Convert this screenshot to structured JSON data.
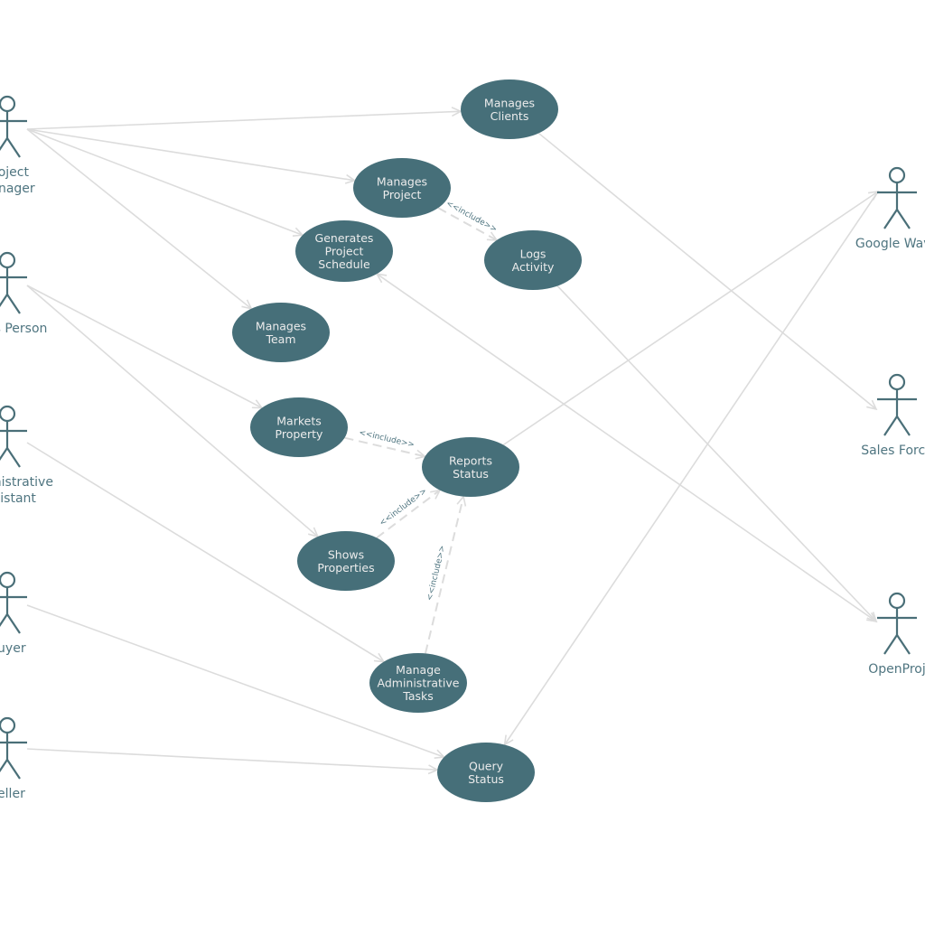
{
  "diagram": {
    "type": "UML use case diagram",
    "colors": {
      "use_case_fill": "#466f79",
      "use_case_text": "#ececec",
      "actor_stroke": "#4a6f78",
      "actor_label": "#4f7580",
      "connector": "#dcdcdc"
    },
    "actors": [
      {
        "id": "project-manager",
        "label_lines": [
          "Project",
          "Manager"
        ],
        "side": "left"
      },
      {
        "id": "sales-person",
        "label_lines": [
          "Sales Person"
        ],
        "side": "left"
      },
      {
        "id": "administrative-assistant",
        "label_lines": [
          "Administrative",
          "Assistant"
        ],
        "side": "left"
      },
      {
        "id": "buyer",
        "label_lines": [
          "Buyer"
        ],
        "side": "left"
      },
      {
        "id": "seller",
        "label_lines": [
          "Seller"
        ],
        "side": "left"
      },
      {
        "id": "google-wave",
        "label_lines": [
          "Google Wave"
        ],
        "side": "right"
      },
      {
        "id": "sales-force",
        "label_lines": [
          "Sales Force"
        ],
        "side": "right"
      },
      {
        "id": "openproj",
        "label_lines": [
          "OpenProj"
        ],
        "side": "right"
      }
    ],
    "use_cases": [
      {
        "id": "manages-clients",
        "label_lines": [
          "Manages",
          "Clients"
        ]
      },
      {
        "id": "manages-project",
        "label_lines": [
          "Manages",
          "Project"
        ]
      },
      {
        "id": "generates-project-schedule",
        "label_lines": [
          "Generates",
          "Project",
          "Schedule"
        ]
      },
      {
        "id": "logs-activity",
        "label_lines": [
          "Logs",
          "Activity"
        ]
      },
      {
        "id": "manages-team",
        "label_lines": [
          "Manages",
          "Team"
        ]
      },
      {
        "id": "markets-property",
        "label_lines": [
          "Markets",
          "Property"
        ]
      },
      {
        "id": "reports-status",
        "label_lines": [
          "Reports",
          "Status"
        ]
      },
      {
        "id": "shows-properties",
        "label_lines": [
          "Shows",
          "Properties"
        ]
      },
      {
        "id": "manage-administrative-tasks",
        "label_lines": [
          "Manage",
          "Administrative",
          "Tasks"
        ]
      },
      {
        "id": "query-status",
        "label_lines": [
          "Query",
          "Status"
        ]
      }
    ],
    "associations": [
      {
        "from": "project-manager",
        "to": "manages-clients",
        "arrow_end": true
      },
      {
        "from": "project-manager",
        "to": "manages-project",
        "arrow_end": true
      },
      {
        "from": "project-manager",
        "to": "generates-project-schedule",
        "arrow_end": true
      },
      {
        "from": "project-manager",
        "to": "manages-team",
        "arrow_end": true
      },
      {
        "from": "sales-person",
        "to": "markets-property",
        "arrow_end": true
      },
      {
        "from": "sales-person",
        "to": "shows-properties",
        "arrow_end": true
      },
      {
        "from": "administrative-assistant",
        "to": "manage-administrative-tasks",
        "arrow_end": true
      },
      {
        "from": "buyer",
        "to": "query-status",
        "arrow_end": true
      },
      {
        "from": "seller",
        "to": "query-status",
        "arrow_end": true
      },
      {
        "from": "manages-clients",
        "to": "sales-force",
        "arrow_end": true
      },
      {
        "from": "reports-status",
        "to": "google-wave",
        "arrow_end": true
      },
      {
        "from": "google-wave",
        "to": "query-status",
        "arrow_end": true
      },
      {
        "from": "logs-activity",
        "to": "openproj",
        "arrow_end": true
      },
      {
        "from": "generates-project-schedule",
        "to": "openproj",
        "arrow_end": true,
        "arrow_start": true
      }
    ],
    "includes": [
      {
        "from": "manages-project",
        "to": "logs-activity",
        "label": "<<include>>"
      },
      {
        "from": "markets-property",
        "to": "reports-status",
        "label": "<<include>>"
      },
      {
        "from": "shows-properties",
        "to": "reports-status",
        "label": "<<include>>"
      },
      {
        "from": "manage-administrative-tasks",
        "to": "reports-status",
        "label": "<<include>>"
      }
    ]
  }
}
